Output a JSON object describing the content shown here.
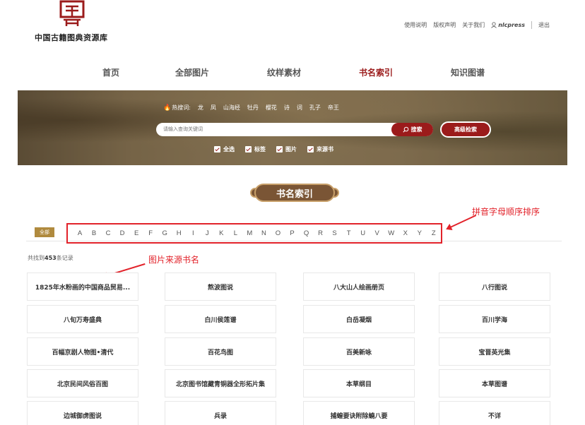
{
  "site": {
    "logo_text": "中国古籍图典资源库",
    "toplinks": [
      "使用说明",
      "版权声明",
      "关于我们"
    ],
    "username": "nlcpress",
    "logout": "退出"
  },
  "nav": [
    "首页",
    "全部图片",
    "纹样素材",
    "书名索引",
    "知识图谱"
  ],
  "nav_active": "书名索引",
  "banner": {
    "hot_label": "热搜词:",
    "hot_keywords": [
      "龙",
      "凤",
      "山海经",
      "牡丹",
      "樱花",
      "诗",
      "词",
      "孔子",
      "帝王"
    ],
    "search_placeholder": "请输入查询关键词",
    "search_button": "搜索",
    "advanced_button": "高级检索",
    "checkboxes": [
      "全选",
      "标签",
      "图片",
      "来源书"
    ]
  },
  "section_title": "书名索引",
  "letter_filter": {
    "all_label": "全部",
    "letters": [
      "A",
      "B",
      "C",
      "D",
      "E",
      "F",
      "G",
      "H",
      "I",
      "J",
      "K",
      "L",
      "M",
      "N",
      "O",
      "P",
      "Q",
      "R",
      "S",
      "T",
      "U",
      "V",
      "W",
      "X",
      "Y",
      "Z"
    ]
  },
  "annotations": {
    "pinyin_order": "拼音字母顺序排序",
    "source_book_name": "图片来源书名"
  },
  "count": {
    "prefix": "共找到",
    "number": "453",
    "suffix": "条记录"
  },
  "books": [
    "1825年水粉画的中国商品贸易...",
    "熬波图说",
    "八大山人绘画册页",
    "八行图说",
    "八旬万寿盛典",
    "白川侯莲谱",
    "白岳凝烟",
    "百川学海",
    "百幅京剧人物图•清代",
    "百花鸟图",
    "百美新咏",
    "宝晋英光集",
    "北京民间风俗百图",
    "北京图书馆藏青铜器全形拓片集",
    "本草纲目",
    "本草图谱",
    "边城御虏图说",
    "兵录",
    "捕蝗要诀附除蝻八要",
    "不详"
  ],
  "colors": {
    "accent": "#9b1b1b",
    "annotation": "#e2222a",
    "tag": "#b08a3e"
  }
}
